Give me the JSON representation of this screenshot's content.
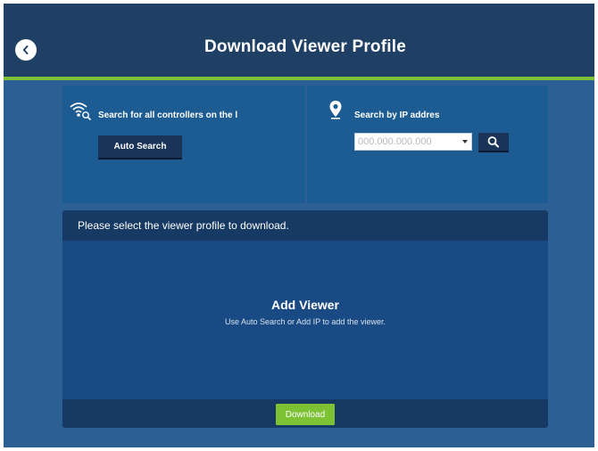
{
  "header": {
    "title": "Download Viewer Profile",
    "back_icon": "chevron-left-icon",
    "accent_color": "#7dc135"
  },
  "auto_search": {
    "icon": "wifi-search-icon",
    "label": "Search for all controllers on the l",
    "button_label": "Auto Search"
  },
  "ip_search": {
    "icon": "location-pin-icon",
    "label": "Search by IP addres",
    "placeholder": "000.000.000.000",
    "search_icon": "search-icon"
  },
  "viewer": {
    "instruction": "Please select the viewer profile to download.",
    "empty_title": "Add Viewer",
    "empty_subtitle": "Use Auto Search or Add IP to add the viewer.",
    "download_label": "Download"
  }
}
